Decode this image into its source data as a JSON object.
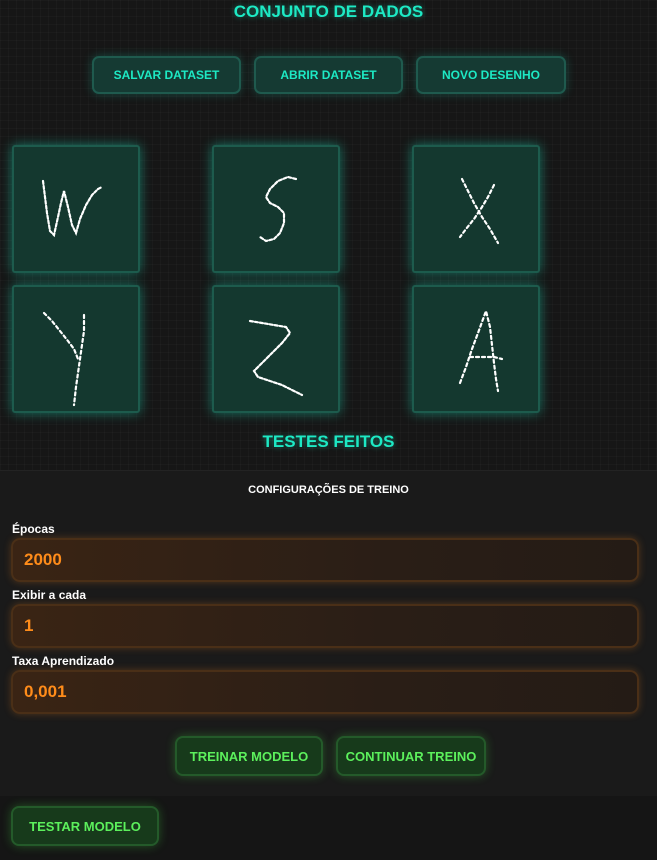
{
  "dataset": {
    "title": "CONJUNTO DE DADOS",
    "buttons": {
      "save": "SALVAR DATASET",
      "open": "ABRIR DATASET",
      "new_drawing": "NOVO DESENHO"
    },
    "samples": [
      {
        "letter": "W"
      },
      {
        "letter": "S"
      },
      {
        "letter": "X"
      },
      {
        "letter": "Y"
      },
      {
        "letter": "Z"
      },
      {
        "letter": "A"
      }
    ]
  },
  "tests": {
    "title": "TESTES FEITOS"
  },
  "config": {
    "title": "CONFIGURAÇÕES DE TREINO",
    "epochs_label": "Épocas",
    "epochs_value": "2000",
    "display_every_label": "Exibir a cada",
    "display_every_value": "1",
    "learning_rate_label": "Taxa Aprendizado",
    "learning_rate_value": "0,001",
    "train_button": "TREINAR MODELO",
    "continue_button": "CONTINUAR TREINO"
  },
  "test_button": "TESTAR MODELO",
  "colors": {
    "accent_teal": "#1de9c4",
    "accent_orange": "#ff8c1a",
    "accent_green": "#5cf05c"
  }
}
